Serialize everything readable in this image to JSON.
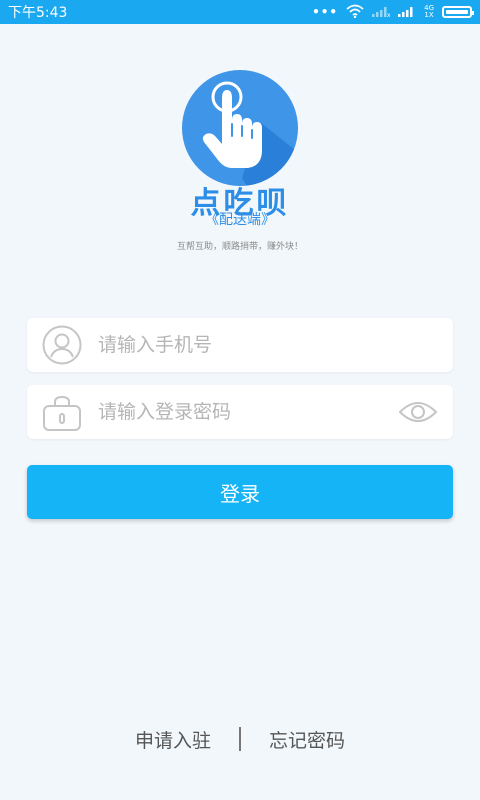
{
  "status_bar": {
    "time": "下午5:43",
    "dots": "•••",
    "network_tag_top": "4G",
    "network_tag_bottom": "1X",
    "background": "#1aa9f0"
  },
  "brand": {
    "name": "点吃呗",
    "subtitle": "《配送端》",
    "slogan": "互帮互助，顺路捎带，赚外块！",
    "logo_color": "#2d8ee8"
  },
  "form": {
    "phone_placeholder": "请输入手机号",
    "password_placeholder": "请输入登录密码",
    "login_label": "登录",
    "accent": "#14b4f6"
  },
  "links": {
    "apply": "申请入驻",
    "forgot": "忘记密码"
  },
  "icons": {
    "user": "user-icon",
    "lock": "lock-icon",
    "eye": "eye-icon",
    "wifi": "wifi-icon",
    "signal": "signal-icon",
    "battery": "battery-icon"
  }
}
